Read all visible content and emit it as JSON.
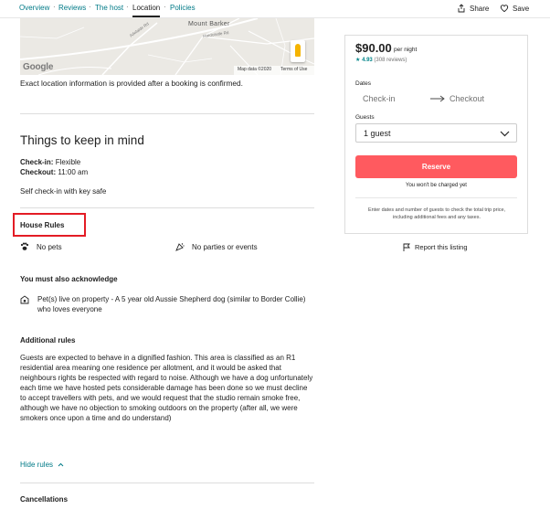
{
  "nav": {
    "tabs": [
      {
        "label": "Overview"
      },
      {
        "label": "Reviews"
      },
      {
        "label": "The host"
      },
      {
        "label": "Location"
      },
      {
        "label": "Policies"
      }
    ],
    "separator": "·",
    "share_label": "Share",
    "save_label": "Save"
  },
  "map": {
    "labels": [
      "Mount Barker",
      "Hardcastle Rd",
      "Adelaide Rd"
    ],
    "logo": "Google",
    "data_text": "Map data ©2020",
    "terms_text": "Terms of Use"
  },
  "location_note": "Exact location information is provided after a booking is confirmed.",
  "things": {
    "title": "Things to keep in mind",
    "checkin_label": "Check-in:",
    "checkin_value": "Flexible",
    "checkout_label": "Checkout:",
    "checkout_value": "11:00 am",
    "self_checkin": "Self check-in with key safe"
  },
  "house_rules": {
    "title": "House Rules",
    "rules": [
      {
        "icon": "no-pets-icon",
        "label": "No pets"
      },
      {
        "icon": "no-parties-icon",
        "label": "No parties or events"
      }
    ]
  },
  "acknowledge": {
    "title": "You must also acknowledge",
    "item": "Pet(s) live on property - A 5 year old Aussie Shepherd dog (similar to Border Collie) who loves everyone"
  },
  "additional": {
    "title": "Additional rules",
    "text": "Guests are expected to behave in a dignified fashion. This area is classified as an R1 residential area meaning one residence per allotment, and it would be asked that neighbours rights be respected with regard to noise. Although we have a dog unfortunately each time we have hosted pets considerable damage has been done so we must decline to accept travellers with pets, and we would request that the studio remain smoke free, although we have no objection to smoking outdoors on the property (after all, we were smokers once upon a time and do understand)"
  },
  "hide_rules_label": "Hide rules",
  "cancellations_title": "Cancellations",
  "booking": {
    "price": "$90.00",
    "per_night": "per night",
    "rating": "4.93",
    "reviews": "(308 reviews)",
    "dates_label": "Dates",
    "checkin_placeholder": "Check-in",
    "checkout_placeholder": "Checkout",
    "guests_label": "Guests",
    "guests_value": "1 guest",
    "reserve_label": "Reserve",
    "no_charge": "You won't be charged yet",
    "enter_dates_note": "Enter dates and number of guests to check the total trip price, including additional fees and any taxes.",
    "report_label": "Report this listing"
  },
  "colors": {
    "accent": "#007a87",
    "reserve": "#ff5a5f",
    "highlight_box": "#e31c25"
  }
}
